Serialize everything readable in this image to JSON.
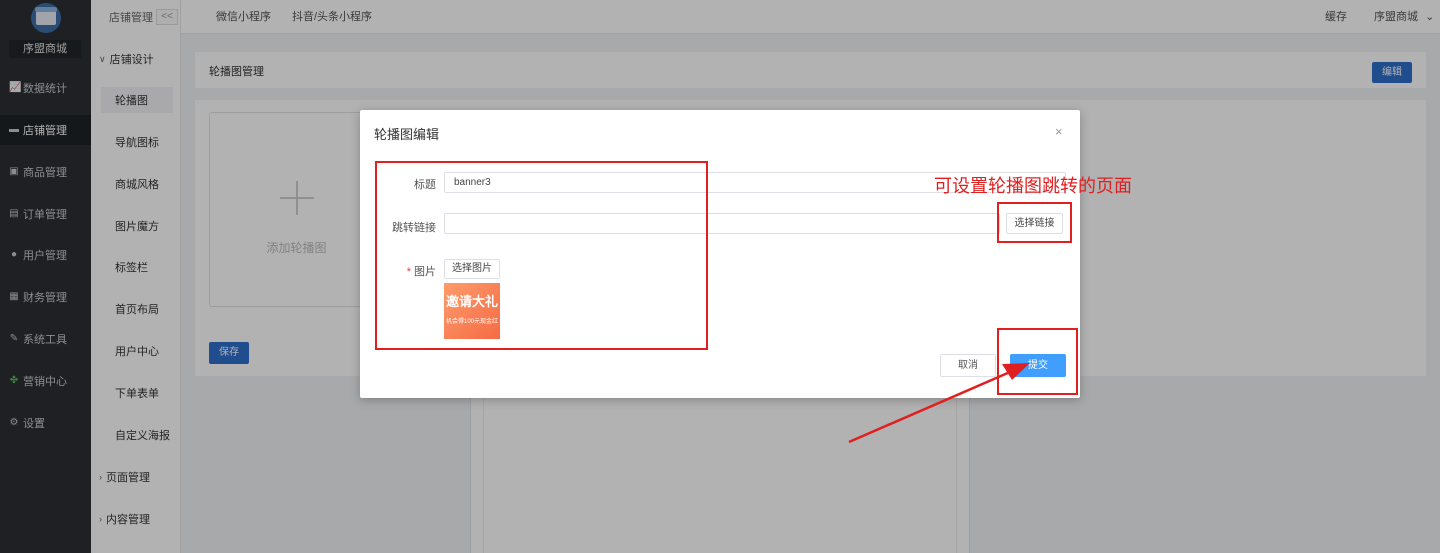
{
  "sidebar": {
    "shop_name": "序盟商城",
    "items": [
      {
        "label": "数据统计",
        "icon": "chart-icon"
      },
      {
        "label": "店铺管理",
        "icon": "store-icon"
      },
      {
        "label": "商品管理",
        "icon": "goods-icon"
      },
      {
        "label": "订单管理",
        "icon": "order-icon"
      },
      {
        "label": "用户管理",
        "icon": "user-icon"
      },
      {
        "label": "财务管理",
        "icon": "finance-icon"
      },
      {
        "label": "系统工具",
        "icon": "wrench-icon"
      },
      {
        "label": "营销中心",
        "icon": "marketing-icon"
      },
      {
        "label": "设置",
        "icon": "gear-icon"
      }
    ]
  },
  "subsidebar": {
    "header": "店铺管理",
    "collapse": "<<",
    "group_design": "店铺设计",
    "items": [
      "轮播图",
      "导航图标",
      "商城风格",
      "图片魔方",
      "标签栏",
      "首页布局",
      "用户中心",
      "下单表单",
      "自定义海报"
    ],
    "group_pages": "页面管理",
    "group_content": "内容管理"
  },
  "topbar": {
    "tabs": [
      "微信小程序",
      "抖音/头条小程序"
    ],
    "cache": "缓存",
    "user": "序盟商城",
    "user_chevron": "⌄"
  },
  "content": {
    "title": "轮播图管理",
    "edit": "编辑",
    "add_label": "添加轮播图",
    "save": "保存"
  },
  "modal": {
    "title": "轮播图编辑",
    "close": "×",
    "title_label": "标题",
    "title_value": "banner3",
    "link_label": "跳转链接",
    "link_value": "",
    "select_link": "选择链接",
    "image_required": "*",
    "image_label": "图片",
    "select_image": "选择图片",
    "thumb_big": "邀请大礼",
    "thumb_small": "机会得100元现金红",
    "cancel": "取消",
    "submit": "提交"
  },
  "annotation": {
    "text": "可设置轮播图跳转的页面",
    "color": "#e02020"
  },
  "colors": {
    "primary": "#409eff",
    "dark_blue": "#2f6fca",
    "sidebar_bg": "#2b2f33"
  }
}
